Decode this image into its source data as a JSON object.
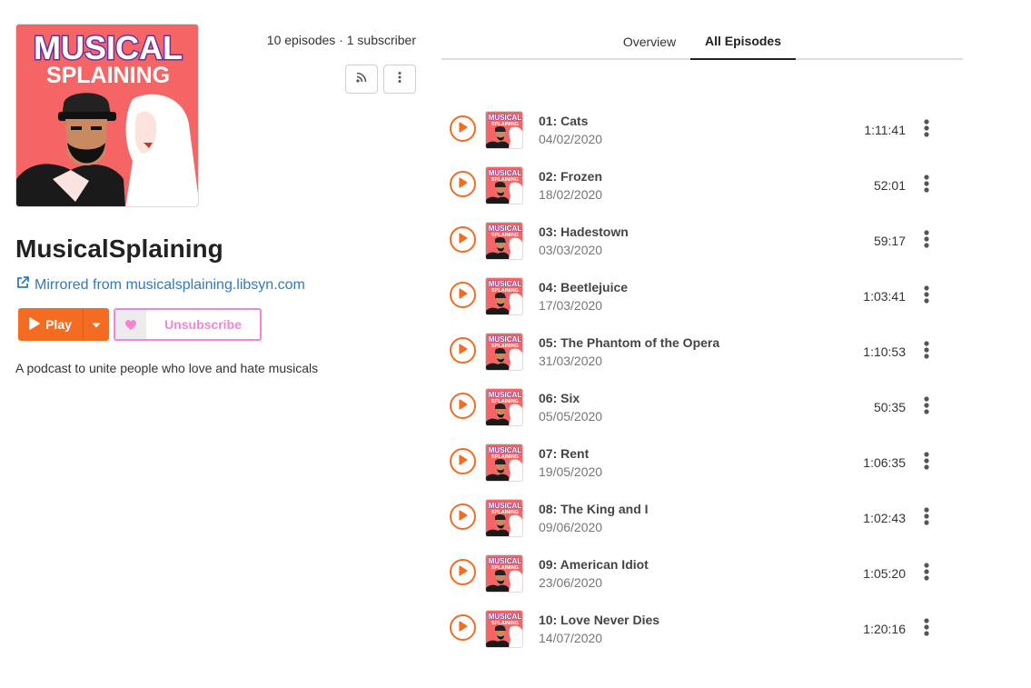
{
  "podcast": {
    "logo_text_top": "MUSICAL",
    "logo_text_bottom": "SPLAINING",
    "title": "MusicalSplaining",
    "mirror_text": "Mirrored from musicalsplaining.libsyn.com",
    "description": "A podcast to unite people who love and hate musicals",
    "stats": "10 episodes · 1 subscriber"
  },
  "actions": {
    "play_label": "Play",
    "unsubscribe_label": "Unsubscribe"
  },
  "tabs": [
    {
      "label": "Overview",
      "active": false
    },
    {
      "label": "All Episodes",
      "active": true
    }
  ],
  "episodes": [
    {
      "title": "01: Cats",
      "date": "04/02/2020",
      "duration": "1:11:41"
    },
    {
      "title": "02: Frozen",
      "date": "18/02/2020",
      "duration": "52:01"
    },
    {
      "title": "03: Hadestown",
      "date": "03/03/2020",
      "duration": "59:17"
    },
    {
      "title": "04: Beetlejuice",
      "date": "17/03/2020",
      "duration": "1:03:41"
    },
    {
      "title": "05: The Phantom of the Opera",
      "date": "31/03/2020",
      "duration": "1:10:53"
    },
    {
      "title": "06: Six",
      "date": "05/05/2020",
      "duration": "50:35"
    },
    {
      "title": "07: Rent",
      "date": "19/05/2020",
      "duration": "1:06:35"
    },
    {
      "title": "08: The King and I",
      "date": "09/06/2020",
      "duration": "1:02:43"
    },
    {
      "title": "09: American Idiot",
      "date": "23/06/2020",
      "duration": "1:05:20"
    },
    {
      "title": "10: Love Never Dies",
      "date": "14/07/2020",
      "duration": "1:20:16"
    }
  ],
  "colors": {
    "accent_orange": "#f36c21",
    "accent_pink": "#f585d4",
    "link_blue": "#337ab7",
    "cover_red": "#f56565",
    "logo_purple": "#6b2fa3"
  },
  "icons": {
    "rss": "rss-icon",
    "more": "vertical-ellipsis-icon",
    "external_link": "external-link-icon",
    "play": "play-icon",
    "caret": "caret-down-icon",
    "heart": "heart-icon"
  }
}
